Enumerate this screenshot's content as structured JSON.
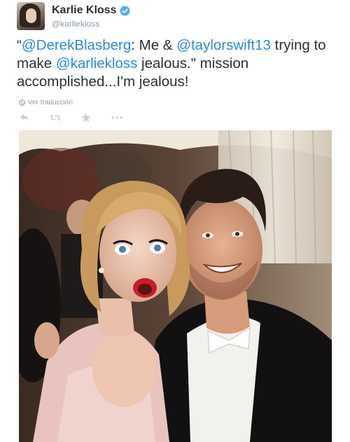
{
  "tweet": {
    "author": {
      "display_name": "Karlie Kloss",
      "handle": "@karliekloss",
      "verified_icon": "verified-badge-icon",
      "avatar_icon": "avatar"
    },
    "text": {
      "open_quote": "“",
      "mention_1": "@DerekBlasberg",
      "part_1": ": Me & ",
      "mention_2": "@taylorswift13",
      "part_2": " trying to make ",
      "mention_3": "@karliekloss",
      "part_3": " jealous.\" mission accomplished...I'm jealous!"
    },
    "translate_label": "Ver traducción",
    "actions": [
      "reply-icon",
      "retweet-icon",
      "favorite-icon",
      "more-icon"
    ],
    "photo_description": "selfie-photo"
  },
  "colors": {
    "mention": "#2a8ad4",
    "text": "#292f33",
    "secondary": "#8899a6",
    "verified": "#55acee"
  }
}
